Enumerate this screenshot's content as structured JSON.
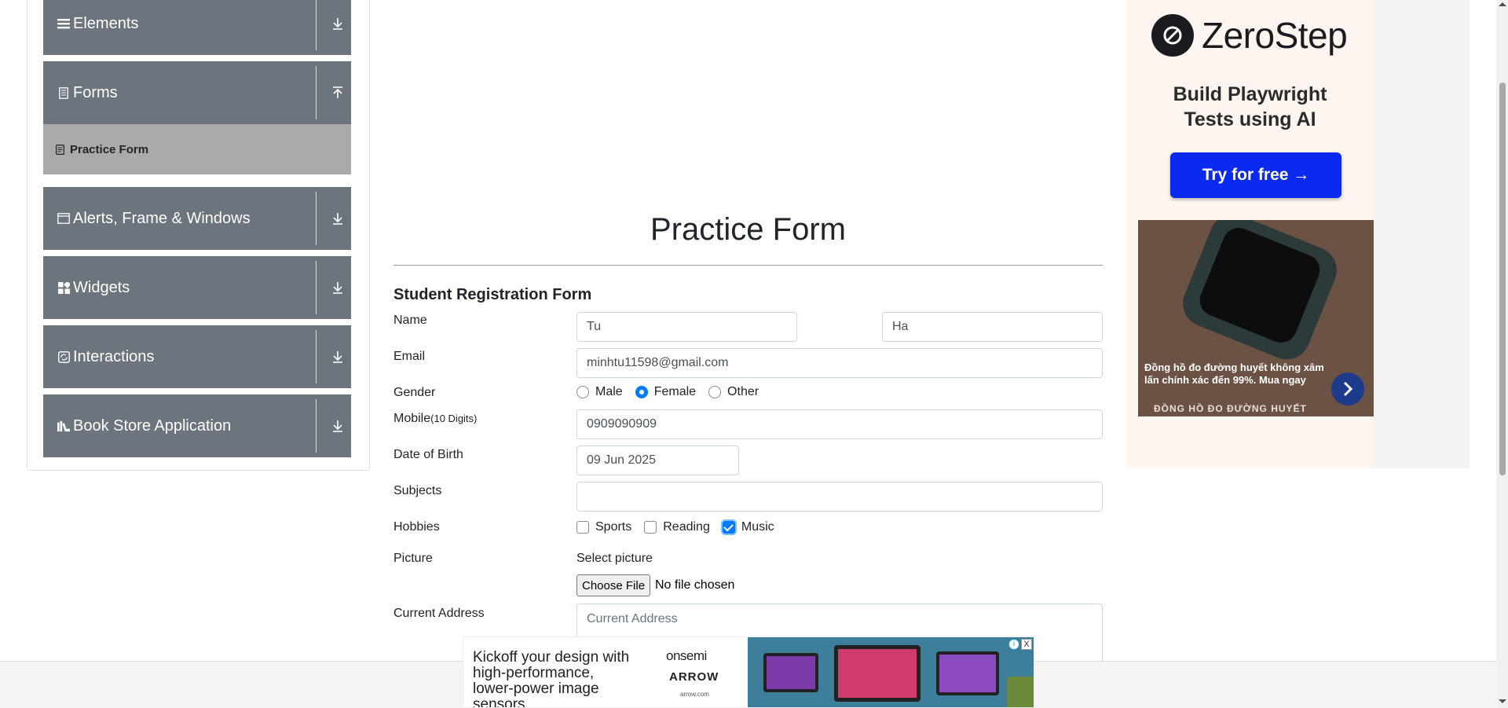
{
  "sidebar": {
    "groups": [
      {
        "label": "Elements",
        "icon": "hamburger-icon",
        "arrow": "download-arrow-icon"
      },
      {
        "label": "Forms",
        "icon": "document-icon",
        "arrow": "upload-arrow-icon"
      },
      {
        "label": "Alerts, Frame & Windows",
        "icon": "window-icon",
        "arrow": "download-arrow-icon"
      },
      {
        "label": "Widgets",
        "icon": "widgets-icon",
        "arrow": "download-arrow-icon"
      },
      {
        "label": "Interactions",
        "icon": "interactions-icon",
        "arrow": "download-arrow-icon"
      },
      {
        "label": "Book Store Application",
        "icon": "books-icon",
        "arrow": "download-arrow-icon"
      }
    ],
    "active_item": {
      "label": "Practice Form",
      "icon": "form-icon"
    }
  },
  "main": {
    "title": "Practice Form",
    "form_heading": "Student Registration Form",
    "labels": {
      "name": "Name",
      "email": "Email",
      "gender": "Gender",
      "mobile": "Mobile",
      "mobile_hint": "(10 Digits)",
      "dob": "Date of Birth",
      "subjects": "Subjects",
      "hobbies": "Hobbies",
      "picture": "Picture",
      "address": "Current Address"
    },
    "values": {
      "first_name": "Tu",
      "last_name": "Ha",
      "email": "minhtu11598@gmail.com",
      "mobile": "0909090909",
      "dob": "09 Jun 2025",
      "subjects": ""
    },
    "gender_options": [
      {
        "label": "Male",
        "checked": false
      },
      {
        "label": "Female",
        "checked": true
      },
      {
        "label": "Other",
        "checked": false
      }
    ],
    "hobby_options": [
      {
        "label": "Sports",
        "checked": false
      },
      {
        "label": "Reading",
        "checked": false
      },
      {
        "label": "Music",
        "checked": true
      }
    ],
    "picture": {
      "select_text": "Select picture",
      "button": "Choose File",
      "status": "No file chosen"
    },
    "address_placeholder": "Current Address"
  },
  "right_ad": {
    "brand": "ZeroStep",
    "headline_1": "Build Playwright",
    "headline_2": "Tests using AI",
    "cta": "Try for free →",
    "watch_text": "Đồng hồ đo đường huyết không xâm lấn chính xác đến 99%. Mua ngay",
    "watch_brand": "ĐỒNG HỒ ĐO ĐƯỜNG HUYẾT"
  },
  "bottom_ad": {
    "text": "Kickoff your design with high-performance, lower-power image sensors",
    "brand_1": "onsemi",
    "brand_2": "ARROW",
    "brand_3": "arrow.com",
    "info": "i",
    "close": "X"
  },
  "colors": {
    "sidebar_bg": "#6c757d",
    "active_item_bg": "#aaaaaa",
    "accent": "#007bff",
    "cta_blue": "#0a2af0"
  }
}
